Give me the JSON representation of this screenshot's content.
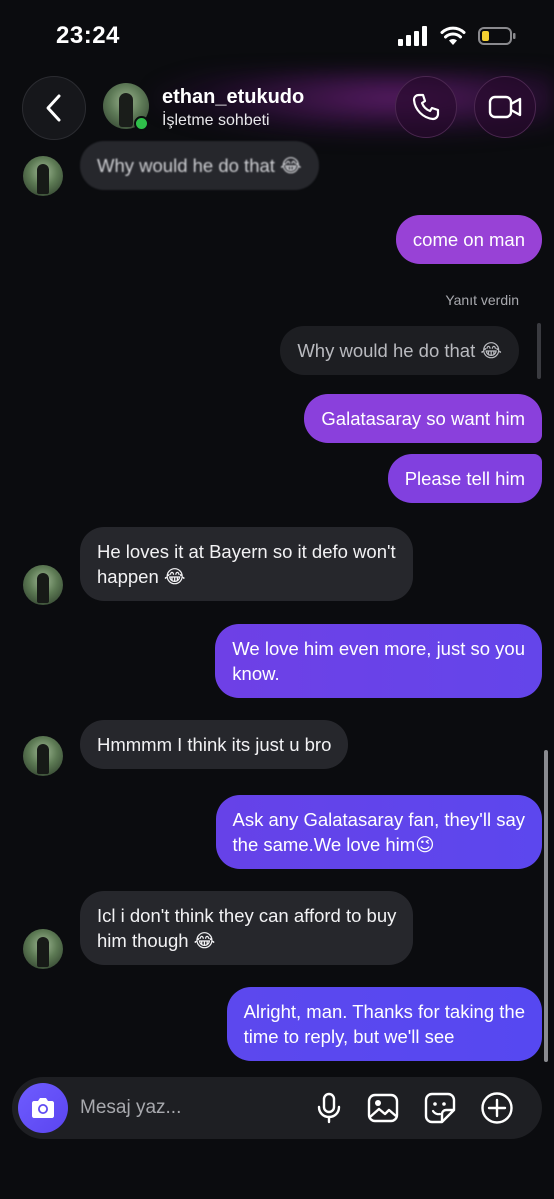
{
  "status": {
    "time": "23:24"
  },
  "header": {
    "name": "ethan_etukudo",
    "subtitle": "İşletme sohbeti"
  },
  "messages": [
    {
      "text": "Why would he do that 😂"
    },
    {
      "text": "come on man"
    },
    {
      "text": "Why would he do that 😂"
    },
    {
      "text": "Galatasaray so want him"
    },
    {
      "text": "Please tell him"
    },
    {
      "line1": "He loves it at Bayern so it defo won't",
      "line2": "happen 😂"
    },
    {
      "line1": "We love him even more, just so you",
      "line2": "know."
    },
    {
      "text": "Hmmmm I think its just u bro"
    },
    {
      "line1": "Ask any Galatasaray fan, they'll say",
      "line2": "the same.We love him😉"
    },
    {
      "line1": "Icl i don't think they can afford to buy",
      "line2": "him though 😂"
    },
    {
      "line1": "Alright, man. Thanks for taking the",
      "line2": "time to reply, but we'll see"
    }
  ],
  "reply_label": "Yanıt verdin",
  "composer": {
    "placeholder": "Mesaj yaz..."
  },
  "colors": {
    "outgoing_start": "#8e3fd8",
    "outgoing_end": "#5a45ee",
    "incoming": "#26272c",
    "accent": "#6552f5"
  }
}
